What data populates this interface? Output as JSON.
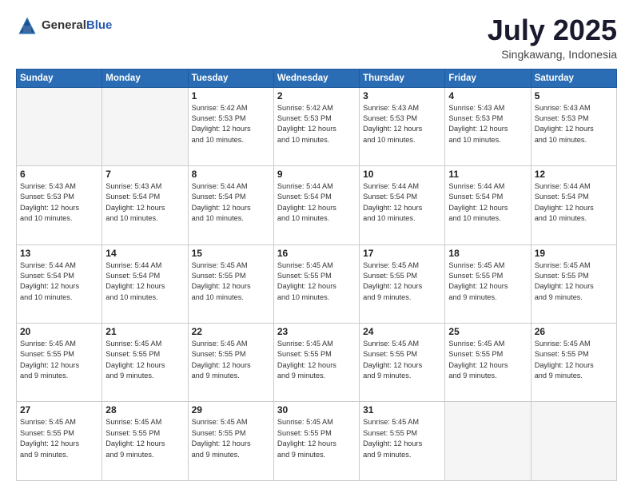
{
  "logo": {
    "text_general": "General",
    "text_blue": "Blue"
  },
  "header": {
    "month": "July 2025",
    "location": "Singkawang, Indonesia"
  },
  "days_of_week": [
    "Sunday",
    "Monday",
    "Tuesday",
    "Wednesday",
    "Thursday",
    "Friday",
    "Saturday"
  ],
  "weeks": [
    [
      {
        "day": "",
        "info": ""
      },
      {
        "day": "",
        "info": ""
      },
      {
        "day": "1",
        "info": "Sunrise: 5:42 AM\nSunset: 5:53 PM\nDaylight: 12 hours\nand 10 minutes."
      },
      {
        "day": "2",
        "info": "Sunrise: 5:42 AM\nSunset: 5:53 PM\nDaylight: 12 hours\nand 10 minutes."
      },
      {
        "day": "3",
        "info": "Sunrise: 5:43 AM\nSunset: 5:53 PM\nDaylight: 12 hours\nand 10 minutes."
      },
      {
        "day": "4",
        "info": "Sunrise: 5:43 AM\nSunset: 5:53 PM\nDaylight: 12 hours\nand 10 minutes."
      },
      {
        "day": "5",
        "info": "Sunrise: 5:43 AM\nSunset: 5:53 PM\nDaylight: 12 hours\nand 10 minutes."
      }
    ],
    [
      {
        "day": "6",
        "info": "Sunrise: 5:43 AM\nSunset: 5:53 PM\nDaylight: 12 hours\nand 10 minutes."
      },
      {
        "day": "7",
        "info": "Sunrise: 5:43 AM\nSunset: 5:54 PM\nDaylight: 12 hours\nand 10 minutes."
      },
      {
        "day": "8",
        "info": "Sunrise: 5:44 AM\nSunset: 5:54 PM\nDaylight: 12 hours\nand 10 minutes."
      },
      {
        "day": "9",
        "info": "Sunrise: 5:44 AM\nSunset: 5:54 PM\nDaylight: 12 hours\nand 10 minutes."
      },
      {
        "day": "10",
        "info": "Sunrise: 5:44 AM\nSunset: 5:54 PM\nDaylight: 12 hours\nand 10 minutes."
      },
      {
        "day": "11",
        "info": "Sunrise: 5:44 AM\nSunset: 5:54 PM\nDaylight: 12 hours\nand 10 minutes."
      },
      {
        "day": "12",
        "info": "Sunrise: 5:44 AM\nSunset: 5:54 PM\nDaylight: 12 hours\nand 10 minutes."
      }
    ],
    [
      {
        "day": "13",
        "info": "Sunrise: 5:44 AM\nSunset: 5:54 PM\nDaylight: 12 hours\nand 10 minutes."
      },
      {
        "day": "14",
        "info": "Sunrise: 5:44 AM\nSunset: 5:54 PM\nDaylight: 12 hours\nand 10 minutes."
      },
      {
        "day": "15",
        "info": "Sunrise: 5:45 AM\nSunset: 5:55 PM\nDaylight: 12 hours\nand 10 minutes."
      },
      {
        "day": "16",
        "info": "Sunrise: 5:45 AM\nSunset: 5:55 PM\nDaylight: 12 hours\nand 10 minutes."
      },
      {
        "day": "17",
        "info": "Sunrise: 5:45 AM\nSunset: 5:55 PM\nDaylight: 12 hours\nand 9 minutes."
      },
      {
        "day": "18",
        "info": "Sunrise: 5:45 AM\nSunset: 5:55 PM\nDaylight: 12 hours\nand 9 minutes."
      },
      {
        "day": "19",
        "info": "Sunrise: 5:45 AM\nSunset: 5:55 PM\nDaylight: 12 hours\nand 9 minutes."
      }
    ],
    [
      {
        "day": "20",
        "info": "Sunrise: 5:45 AM\nSunset: 5:55 PM\nDaylight: 12 hours\nand 9 minutes."
      },
      {
        "day": "21",
        "info": "Sunrise: 5:45 AM\nSunset: 5:55 PM\nDaylight: 12 hours\nand 9 minutes."
      },
      {
        "day": "22",
        "info": "Sunrise: 5:45 AM\nSunset: 5:55 PM\nDaylight: 12 hours\nand 9 minutes."
      },
      {
        "day": "23",
        "info": "Sunrise: 5:45 AM\nSunset: 5:55 PM\nDaylight: 12 hours\nand 9 minutes."
      },
      {
        "day": "24",
        "info": "Sunrise: 5:45 AM\nSunset: 5:55 PM\nDaylight: 12 hours\nand 9 minutes."
      },
      {
        "day": "25",
        "info": "Sunrise: 5:45 AM\nSunset: 5:55 PM\nDaylight: 12 hours\nand 9 minutes."
      },
      {
        "day": "26",
        "info": "Sunrise: 5:45 AM\nSunset: 5:55 PM\nDaylight: 12 hours\nand 9 minutes."
      }
    ],
    [
      {
        "day": "27",
        "info": "Sunrise: 5:45 AM\nSunset: 5:55 PM\nDaylight: 12 hours\nand 9 minutes."
      },
      {
        "day": "28",
        "info": "Sunrise: 5:45 AM\nSunset: 5:55 PM\nDaylight: 12 hours\nand 9 minutes."
      },
      {
        "day": "29",
        "info": "Sunrise: 5:45 AM\nSunset: 5:55 PM\nDaylight: 12 hours\nand 9 minutes."
      },
      {
        "day": "30",
        "info": "Sunrise: 5:45 AM\nSunset: 5:55 PM\nDaylight: 12 hours\nand 9 minutes."
      },
      {
        "day": "31",
        "info": "Sunrise: 5:45 AM\nSunset: 5:55 PM\nDaylight: 12 hours\nand 9 minutes."
      },
      {
        "day": "",
        "info": ""
      },
      {
        "day": "",
        "info": ""
      }
    ]
  ]
}
